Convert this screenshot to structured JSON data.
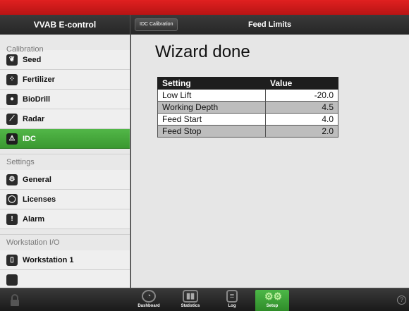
{
  "app": {
    "title": "VVAB E-control"
  },
  "header": {
    "tab_label": "IDC Calibration",
    "title": "Feed Limits"
  },
  "sidebar": {
    "sections": [
      {
        "label": "Calibration",
        "items": [
          "Seed",
          "Fertilizer",
          "BioDrill",
          "Radar",
          "IDC"
        ]
      },
      {
        "label": "Settings",
        "items": [
          "General",
          "Licenses",
          "Alarm"
        ]
      },
      {
        "label": "Workstation I/O",
        "items": [
          "Workstation 1"
        ]
      }
    ],
    "selected": "IDC"
  },
  "main": {
    "heading": "Wizard done",
    "table": {
      "headers": [
        "Setting",
        "Value"
      ],
      "rows": [
        [
          "Low Lift",
          "-20.0"
        ],
        [
          "Working Depth",
          "4.5"
        ],
        [
          "Feed Start",
          "4.0"
        ],
        [
          "Feed Stop",
          "2.0"
        ]
      ]
    }
  },
  "bottom_nav": {
    "items": [
      {
        "label": "Dashboard",
        "icon": "gauge-icon"
      },
      {
        "label": "Statistics",
        "icon": "bar-chart-icon"
      },
      {
        "label": "Log",
        "icon": "clipboard-icon"
      },
      {
        "label": "Setup",
        "icon": "gears-icon"
      }
    ],
    "active": "Setup",
    "help_glyph": "?"
  },
  "colors": {
    "accent_red": "#d01818",
    "selected_green": "#46a83c"
  }
}
